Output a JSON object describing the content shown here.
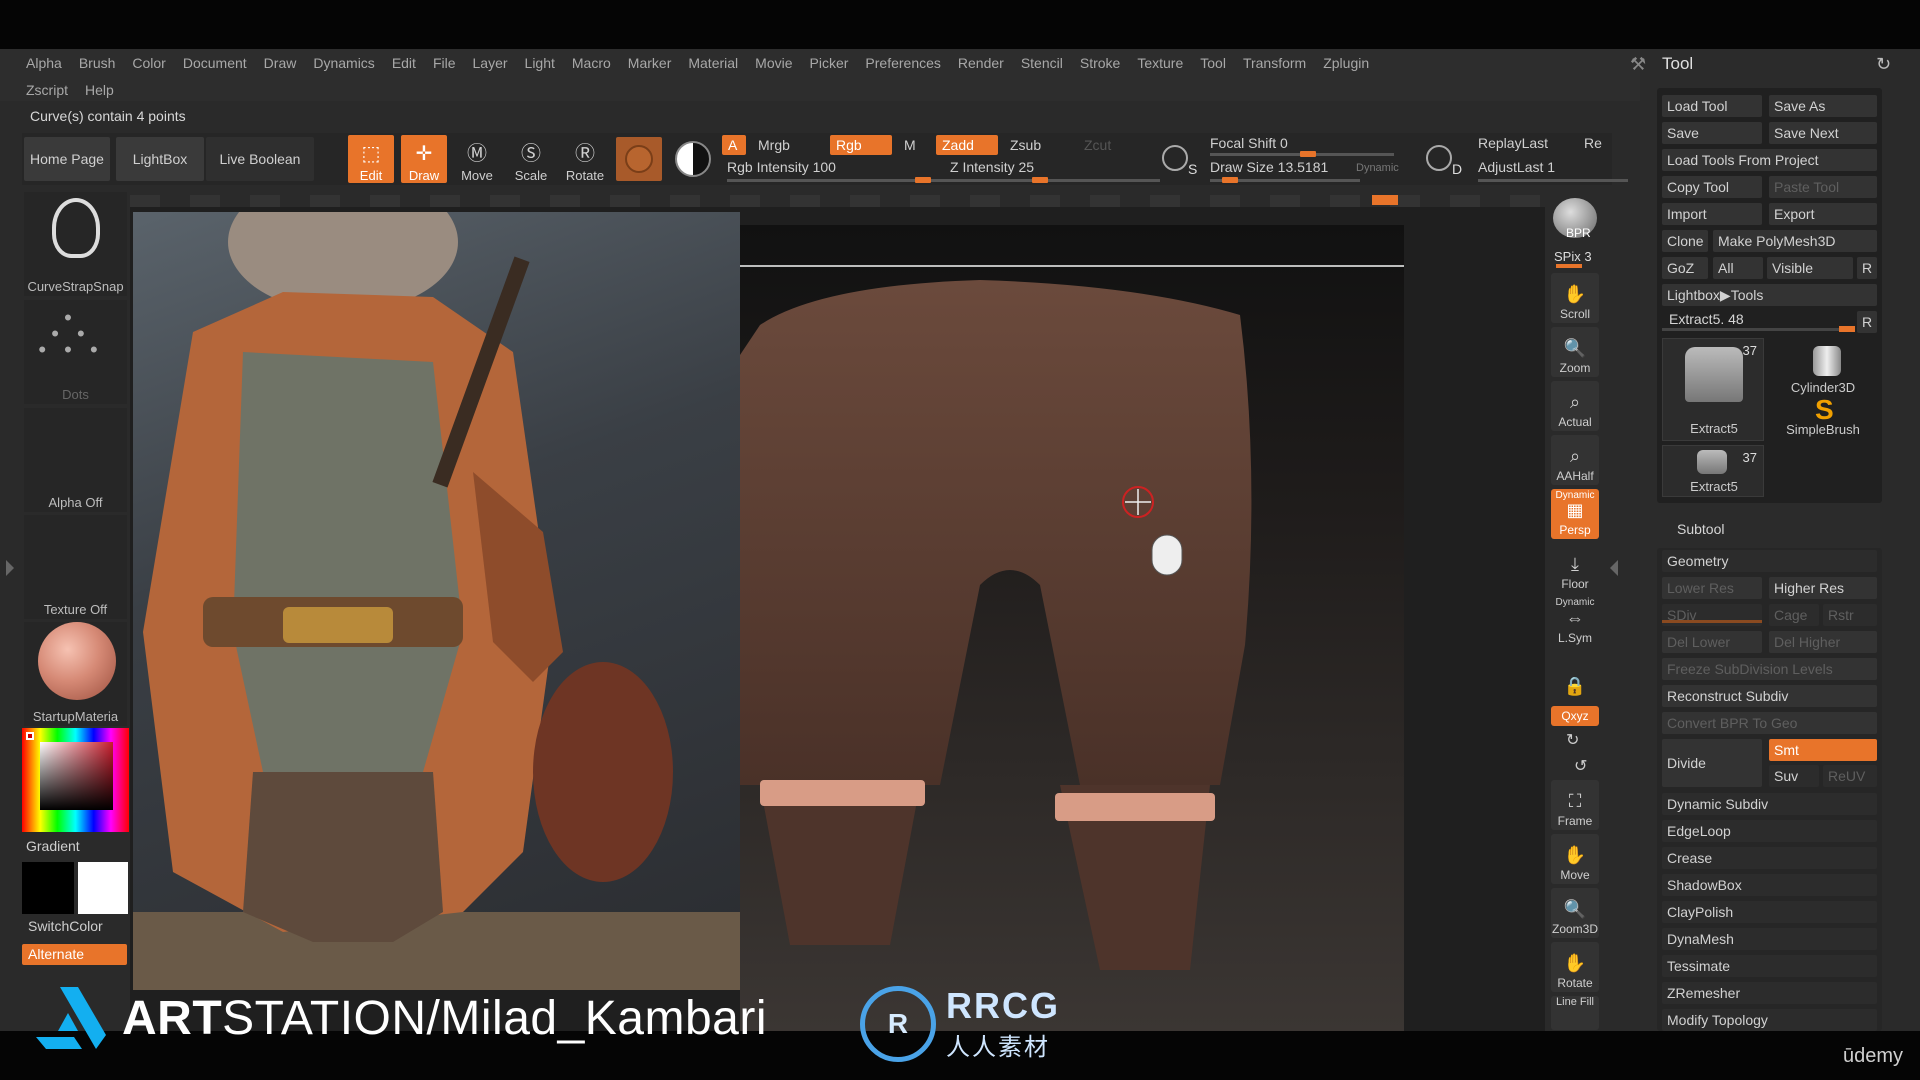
{
  "menu": {
    "row1": [
      "Alpha",
      "Brush",
      "Color",
      "Document",
      "Draw",
      "Dynamics",
      "Edit",
      "File",
      "Layer",
      "Light",
      "Macro",
      "Marker",
      "Material",
      "Movie",
      "Picker",
      "Preferences",
      "Render",
      "Stencil",
      "Stroke",
      "Texture",
      "Tool",
      "Transform",
      "Zplugin"
    ],
    "row2": [
      "Zscript",
      "Help"
    ]
  },
  "status": "Curve(s) contain 4 points",
  "toolbar": {
    "home": "Home Page",
    "lightbox": "LightBox",
    "live_boolean": "Live Boolean",
    "edit": "Edit",
    "draw": "Draw",
    "move": "Move",
    "scale": "Scale",
    "rotate": "Rotate",
    "a": "A",
    "mrgb": "Mrgb",
    "rgb": "Rgb",
    "m": "M",
    "zadd": "Zadd",
    "zsub": "Zsub",
    "zcut": "Zcut",
    "rgb_intensity": "Rgb Intensity 100",
    "z_intensity": "Z Intensity 25",
    "focal_shift": "Focal Shift 0",
    "draw_size": "Draw Size 13.5181",
    "dynamic": "Dynamic",
    "replay_last": "ReplayLast",
    "re": "Re",
    "adjust_last": "AdjustLast 1",
    "s_label": "S",
    "d_label": "D"
  },
  "left_shelf": {
    "brush": "CurveStrapSnap",
    "stroke": "Dots",
    "alpha": "Alpha Off",
    "texture": "Texture Off",
    "material": "StartupMateria",
    "gradient": "Gradient",
    "switch_color": "SwitchColor",
    "alternate": "Alternate"
  },
  "right_shelf": {
    "bpr": "BPR",
    "spix": "SPix 3",
    "scroll": "Scroll",
    "zoom": "Zoom",
    "actual": "Actual",
    "aahalf": "AAHalf",
    "persp": "Persp",
    "dynamic": "Dynamic",
    "floor": "Floor",
    "lsym": "L.Sym",
    "xyz": "Qxyz",
    "frame": "Frame",
    "move": "Move",
    "zoom3d": "Zoom3D",
    "rotate": "Rotate",
    "linefill": "Line Fill"
  },
  "tool_panel": {
    "title": "Tool",
    "load_tool": "Load Tool",
    "save_as": "Save As",
    "save": "Save",
    "save_next": "Save Next",
    "load_from_project": "Load Tools From Project",
    "copy_tool": "Copy Tool",
    "paste_tool": "Paste Tool",
    "import": "Import",
    "export": "Export",
    "clone": "Clone",
    "make_polymesh": "Make PolyMesh3D",
    "goz": "GoZ",
    "all": "All",
    "visible": "Visible",
    "r": "R",
    "lightbox_tools": "Lightbox▶Tools",
    "extract_slider": "Extract5. 48",
    "tool1_name": "Extract5",
    "tool1_count": "37",
    "tool2_name": "Cylinder3D",
    "tool3_name": "SimpleBrush",
    "tool4_name": "Extract5",
    "tool4_count": "37",
    "subtool": "Subtool",
    "geometry": "Geometry",
    "lower_res": "Lower Res",
    "higher_res": "Higher Res",
    "sdiv": "SDiv",
    "cage": "Cage",
    "rstr": "Rstr",
    "del_lower": "Del Lower",
    "del_higher": "Del Higher",
    "freeze": "Freeze SubDivision Levels",
    "reconstruct": "Reconstruct Subdiv",
    "convert_bpr": "Convert BPR To Geo",
    "divide": "Divide",
    "smt": "Smt",
    "suv": "Suv",
    "reuv": "ReUV",
    "sections": [
      "Dynamic Subdiv",
      "EdgeLoop",
      "Crease",
      "ShadowBox",
      "ClayPolish",
      "DynaMesh",
      "Tessimate",
      "ZRemesher",
      "Modify Topology"
    ]
  },
  "watermark": {
    "artstation_a": "ART",
    "artstation_b": "STATION/Milad_Kambari",
    "rrcg": "RRCG",
    "rrcg_cn": "人人素材",
    "udemy": "ūdemy"
  },
  "colors": {
    "accent": "#e8742a"
  }
}
